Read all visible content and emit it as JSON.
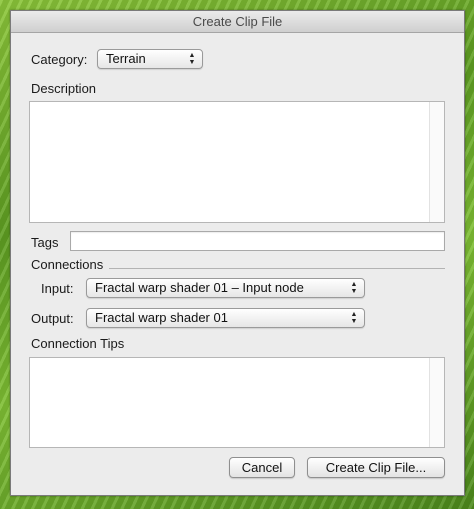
{
  "window": {
    "title": "Create Clip File"
  },
  "category": {
    "label": "Category:",
    "value": "Terrain"
  },
  "description": {
    "label": "Description",
    "value": ""
  },
  "tags": {
    "label": "Tags",
    "value": ""
  },
  "connections": {
    "label": "Connections",
    "input_label": "Input:",
    "input_value": "Fractal warp shader 01 – Input node",
    "output_label": "Output:",
    "output_value": "Fractal warp shader 01"
  },
  "connection_tips": {
    "label": "Connection Tips",
    "value": ""
  },
  "buttons": {
    "cancel": "Cancel",
    "create": "Create Clip File..."
  },
  "icons": {
    "popup_arrows": "updown-chevron-icon"
  }
}
